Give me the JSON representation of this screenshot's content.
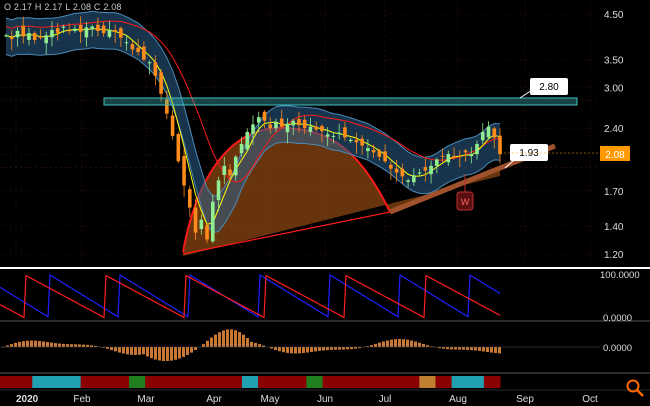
{
  "ohlc": "O 2.17  H 2.17  L 2.08  C 2.08",
  "colors": {
    "background": "#000000",
    "grid": "#3a1010",
    "bull": "#90ee90",
    "bear": "#ff8c1a",
    "bollinger": "#4a8ab8",
    "bollinger_fill": "#2c5f8a",
    "red_line": "#ff1a1a",
    "yellow_line": "#ffff00",
    "cup_fill": "#8b4513",
    "resistance": "#40c0c0",
    "price_tag": "#ff9900",
    "divider": "#ffffff",
    "osc_blue": "#2020ff",
    "osc_red": "#ff2020",
    "hist": "#c87830",
    "label_w": "#c03030"
  },
  "annotations": {
    "resistance_label": "2.80",
    "support_label": "1.93",
    "current_price": "2.08",
    "pattern_label": "W"
  },
  "zoom_icon": "magnifier-icon",
  "chart_data": {
    "type": "candlestick",
    "price_axis": {
      "scale": "log",
      "ticks": [
        "4.50",
        "3.50",
        "3.00",
        "2.80",
        "2.40",
        "2.08",
        "1.93",
        "1.70",
        "1.40",
        "1.20"
      ],
      "range": [
        1.1,
        4.6
      ]
    },
    "x_ticks": [
      "2020",
      "Feb",
      "Mar",
      "Apr",
      "May",
      "Jun",
      "Jul",
      "Aug",
      "Sep",
      "Oct"
    ],
    "oscillator_ticks": [
      "100.0000",
      "0.0000"
    ],
    "histogram_ticks": [
      "0.0000"
    ],
    "closes": [
      4.0,
      3.92,
      4.1,
      3.98,
      4.05,
      3.9,
      3.95,
      4.0,
      4.12,
      4.05,
      4.2,
      4.1,
      4.15,
      4.08,
      4.18,
      4.2,
      4.1,
      4.05,
      4.12,
      4.08,
      3.95,
      3.85,
      3.7,
      3.65,
      3.5,
      3.45,
      3.2,
      2.9,
      2.6,
      2.3,
      2.0,
      1.75,
      1.55,
      1.35,
      1.45,
      1.3,
      1.6,
      1.8,
      1.95,
      1.85,
      2.05,
      2.2,
      2.35,
      2.45,
      2.55,
      2.5,
      2.4,
      2.48,
      2.42,
      2.46,
      2.5,
      2.44,
      2.4,
      2.42,
      2.38,
      2.36,
      2.32,
      2.3,
      2.34,
      2.28,
      2.25,
      2.22,
      2.18,
      2.15,
      2.1,
      2.05,
      2.0,
      1.92,
      1.88,
      1.84,
      1.8,
      1.85,
      1.88,
      1.9,
      1.95,
      2.02,
      2.05,
      2.08,
      2.04,
      2.06,
      2.1,
      2.08,
      2.2,
      2.35,
      2.42,
      2.28,
      2.08
    ]
  }
}
